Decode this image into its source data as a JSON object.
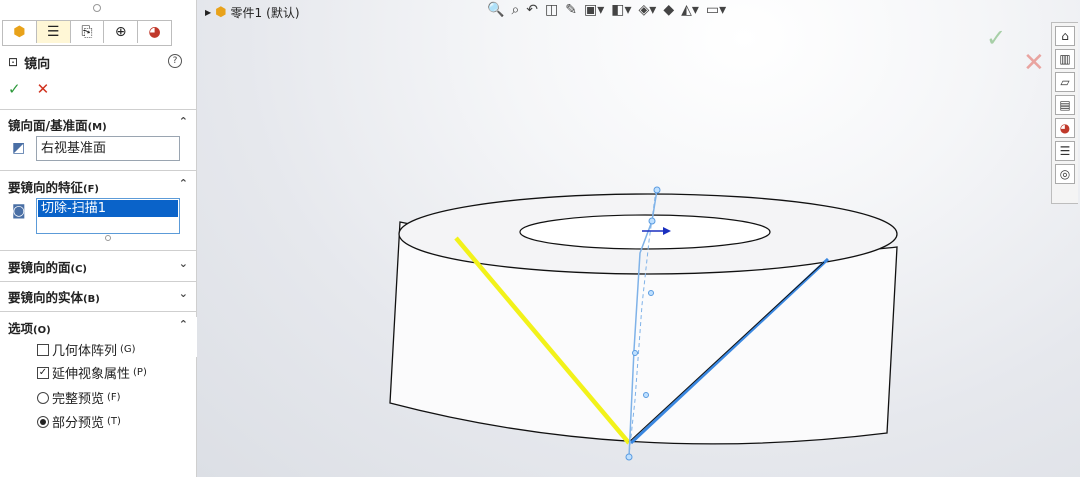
{
  "panel": {
    "tabs": [
      "feature-manager-icon",
      "property-manager-icon",
      "configuration-manager-icon",
      "dimxpert-icon",
      "display-manager-icon"
    ],
    "title": "镜向",
    "help": "?",
    "ok": "✓",
    "cancel": "✕",
    "section_plane": {
      "label": "镜向面/基准面",
      "hotkey": "(M)",
      "value": "右视基准面"
    },
    "section_features": {
      "label": "要镜向的特征",
      "hotkey": "(F)",
      "item": "切除-扫描1"
    },
    "section_faces": {
      "label": "要镜向的面",
      "hotkey": "(C)"
    },
    "section_bodies": {
      "label": "要镜向的实体",
      "hotkey": "(B)"
    },
    "section_options": {
      "label": "选项",
      "hotkey": "(O)",
      "options": [
        {
          "label": "几何体阵列",
          "hotkey": "(G)",
          "type": "checkbox",
          "checked": false
        },
        {
          "label": "延伸视象属性",
          "hotkey": "(P)",
          "type": "checkbox",
          "checked": true
        },
        {
          "label": "完整预览",
          "hotkey": "(F)",
          "type": "radio",
          "checked": false
        },
        {
          "label": "部分预览",
          "hotkey": "(T)",
          "type": "radio",
          "checked": true
        }
      ]
    }
  },
  "viewport": {
    "tree_root": "零件1",
    "tree_config": "(默认)",
    "hud_icons": [
      "zoom-to-fit-icon",
      "zoom-area-icon",
      "previous-view-icon",
      "section-view-icon",
      "dynamic-annotation-icon",
      "view-orientation-icon",
      "display-style-icon",
      "hide-show-icon",
      "edit-appearance-icon",
      "apply-scene-icon",
      "view-settings-icon"
    ],
    "taskpane_icons": [
      "home-icon",
      "resources-icon",
      "design-library-icon",
      "file-explorer-icon",
      "appearances-icon",
      "custom-properties-icon",
      "forum-icon"
    ],
    "colors": {
      "yellow_edge": "#f2f21a",
      "blue_edge": "#3a87e0"
    }
  }
}
